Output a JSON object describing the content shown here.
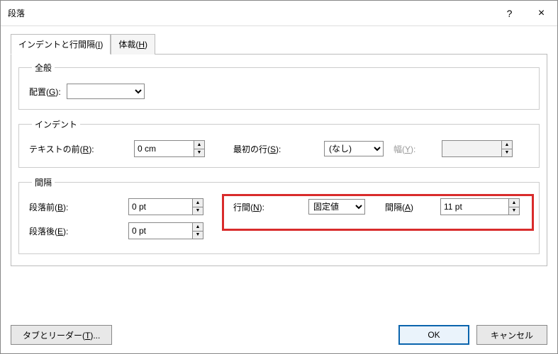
{
  "title": "段落",
  "help": "?",
  "close": "×",
  "tabs": {
    "indent_spacing": "インデントと行間隔(I)",
    "asian": "体裁(H)"
  },
  "general": {
    "legend": "全般",
    "alignment_label": "配置(G):",
    "alignment_value": ""
  },
  "indent": {
    "legend": "インデント",
    "before_label": "テキストの前(R):",
    "before_value": "0 cm",
    "first_label": "最初の行(S):",
    "first_value": "(なし)",
    "width_label": "幅(Y):",
    "width_value": ""
  },
  "spacing": {
    "legend": "間隔",
    "before_label": "段落前(B):",
    "before_value": "0 pt",
    "after_label": "段落後(E):",
    "after_value": "0 pt",
    "line_label": "行間(N):",
    "line_value": "固定値",
    "at_label": "間隔(A)",
    "at_value": "11 pt"
  },
  "footer": {
    "tabs_btn": "タブとリーダー(T)...",
    "ok": "OK",
    "cancel": "キャンセル"
  }
}
